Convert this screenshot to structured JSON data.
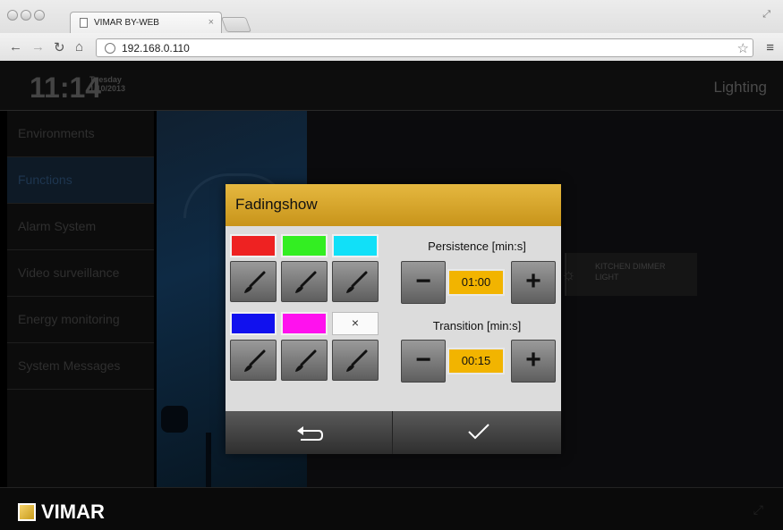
{
  "browser": {
    "tab_title": "VIMAR BY-WEB",
    "tab_close": "×",
    "url": "192.168.0.110"
  },
  "header": {
    "time": "11:14",
    "day": "Tuesday",
    "date": "1/10/2013",
    "section": "Lighting"
  },
  "sidebar": {
    "items": [
      {
        "label": "Environments"
      },
      {
        "label": "Functions"
      },
      {
        "label": "Alarm System"
      },
      {
        "label": "Video surveillance"
      },
      {
        "label": "Energy monitoring"
      },
      {
        "label": "System Messages"
      }
    ]
  },
  "device": {
    "label_line1": "KITCHEN DIMMER",
    "label_line2": "LIGHT"
  },
  "footer": {
    "brand": "VIMAR"
  },
  "dialog": {
    "title": "Fadingshow",
    "swatch_colors": [
      "#ee2222",
      "#33ee22",
      "#11e0f8",
      "#1111ee",
      "#ff11ee",
      ""
    ],
    "empty_swatch": "×",
    "persistence_label": "Persistence [min:s]",
    "persistence_value": "01:00",
    "transition_label": "Transition [min:s]",
    "transition_value": "00:15",
    "minus": "−",
    "plus": "+"
  }
}
